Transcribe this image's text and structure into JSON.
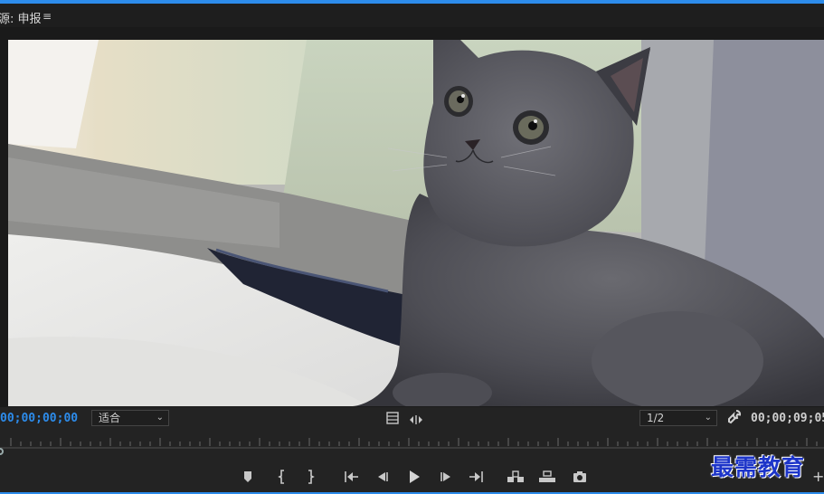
{
  "panel": {
    "title": "源: 申报",
    "menu_icon": "hamburger-menu-icon"
  },
  "video": {
    "subject": "gray-kitten-photo"
  },
  "status": {
    "current_timecode": "00;00;00;00",
    "zoom_value": "适合",
    "resolution_value": "1/2",
    "duration_timecode": "00;00;09;05"
  },
  "transport": {
    "buttons": [
      "add-marker-icon",
      "mark-in-icon",
      "mark-out-icon",
      "go-to-in-icon",
      "step-back-icon",
      "play-icon",
      "step-forward-icon",
      "go-to-out-icon",
      "insert-icon",
      "overwrite-icon",
      "export-frame-icon"
    ]
  },
  "watermark": {
    "text": "最需教育"
  },
  "colors": {
    "accent": "#2d8ceb",
    "panel_bg": "#232323",
    "watermark": "#1d35c9"
  }
}
